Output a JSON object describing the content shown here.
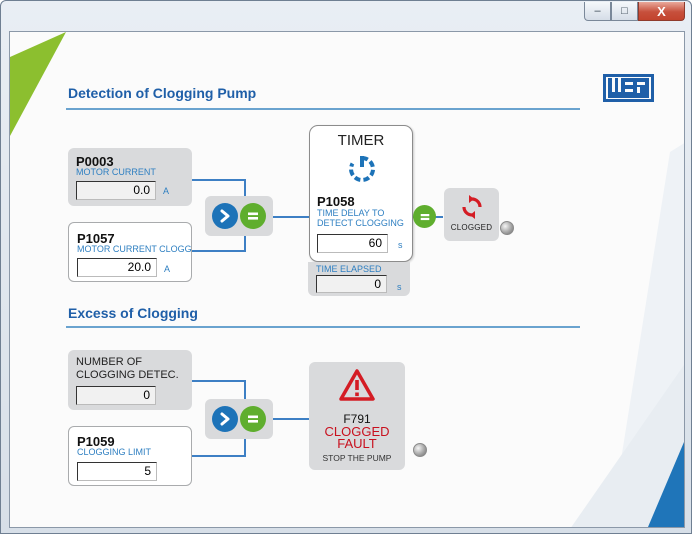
{
  "window": {
    "controls": {
      "minimize": "–",
      "maximize": "□",
      "close": "X"
    }
  },
  "logo": {
    "text": "WEG"
  },
  "sections": {
    "detection": {
      "title": "Detection of Clogging Pump"
    },
    "excess": {
      "title": "Excess of Clogging"
    }
  },
  "p0003": {
    "code": "P0003",
    "desc": "MOTOR CURRENT",
    "value": "0.0",
    "unit": "A"
  },
  "p1057": {
    "code": "P1057",
    "desc": "MOTOR CURRENT CLOGG.",
    "value": "20.0",
    "unit": "A"
  },
  "timer": {
    "title": "TIMER",
    "icon": "power-timer-icon",
    "code": "P1058",
    "desc_line1": "TIME DELAY TO",
    "desc_line2": "DETECT CLOGGING",
    "value": "60",
    "unit": "s"
  },
  "elapsed": {
    "label": "TIME ELAPSED",
    "value": "0",
    "unit": "s"
  },
  "clogged": {
    "label": "CLOGGED",
    "icon": "refresh-icon"
  },
  "detections": {
    "desc_line1": "NUMBER OF",
    "desc_line2": "CLOGGING DETEC.",
    "value": "0"
  },
  "p1059": {
    "code": "P1059",
    "desc": "CLOGGING LIMIT",
    "value": "5"
  },
  "fault": {
    "icon": "warning-icon",
    "code": "F791",
    "line1": "CLOGGED",
    "line2": "FAULT",
    "action": "STOP THE PUMP"
  },
  "colors": {
    "accent_blue": "#1d73b8",
    "accent_green": "#5fae2e",
    "fault_red": "#c8101e",
    "panel_gray": "#d9dadc"
  }
}
